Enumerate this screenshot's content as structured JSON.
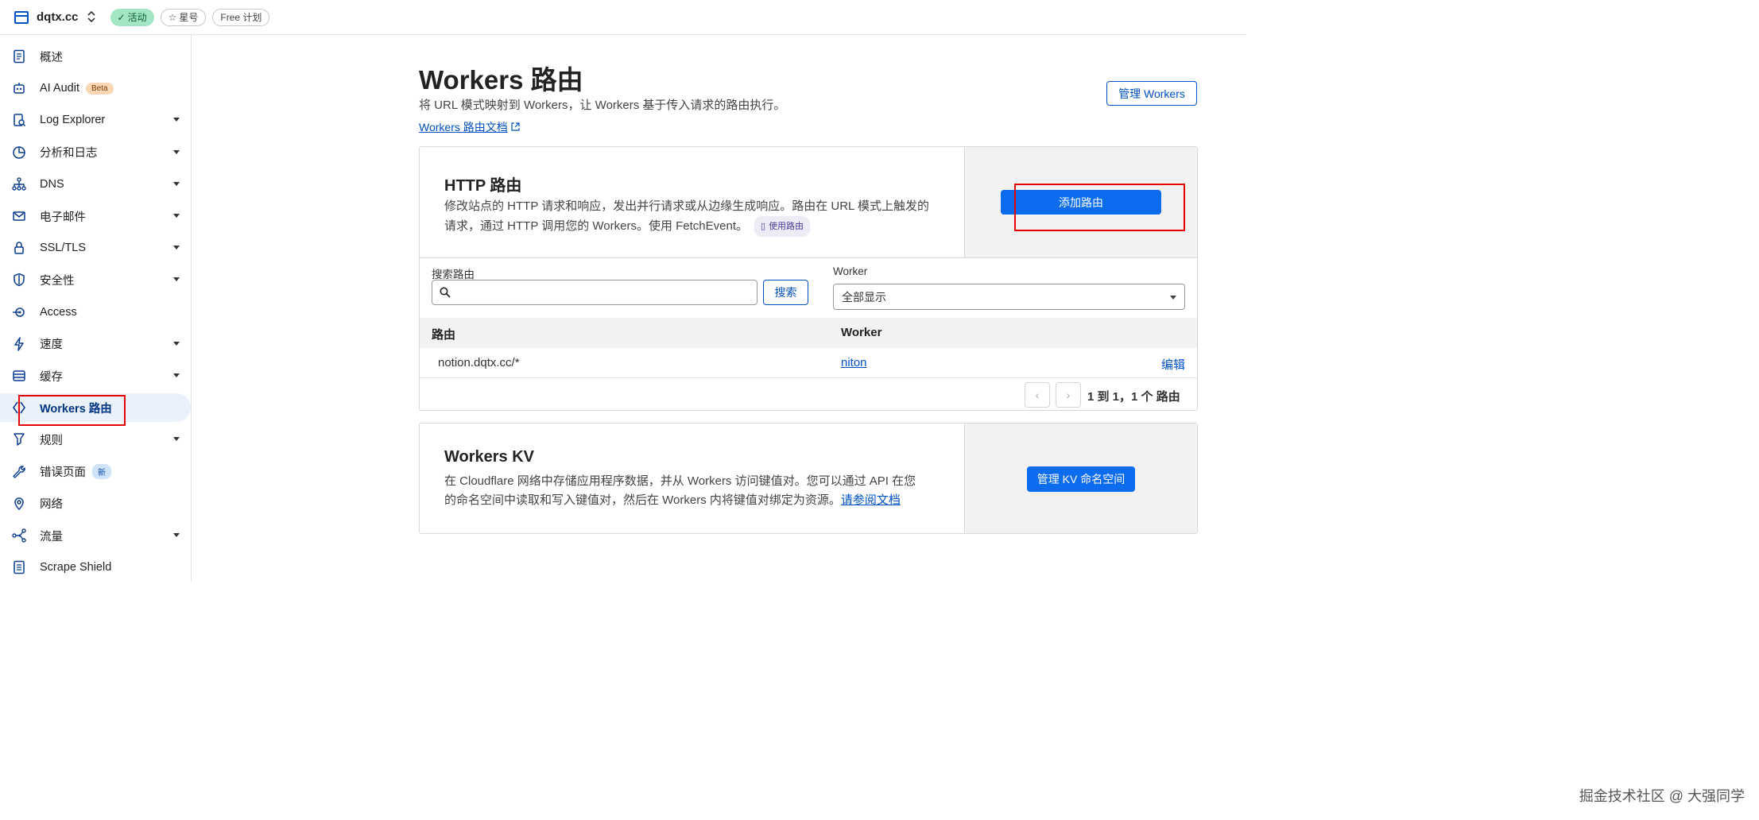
{
  "topbar": {
    "zone_name": "dqtx.cc",
    "zone_switch": "◇",
    "status_pill": "活动",
    "star_pill": "星号",
    "plan_pill": "Free 计划"
  },
  "sidebar": {
    "items": [
      {
        "label": "概述",
        "icon": "document-icon"
      },
      {
        "label": "AI Audit",
        "icon": "robot-icon",
        "badge": "Beta"
      },
      {
        "label": "Log Explorer",
        "icon": "log-icon"
      },
      {
        "label": "分析和日志",
        "icon": "pie-chart-icon"
      },
      {
        "label": "DNS",
        "icon": "network-tree-icon"
      },
      {
        "label": "电子邮件",
        "icon": "email-icon"
      },
      {
        "label": "SSL/TLS",
        "icon": "lock-icon"
      },
      {
        "label": "安全性",
        "icon": "shield-icon"
      },
      {
        "label": "Access",
        "icon": "access-icon"
      },
      {
        "label": "速度",
        "icon": "lightning-icon"
      },
      {
        "label": "缓存",
        "icon": "cache-icon"
      },
      {
        "label": "Workers 路由",
        "icon": "workers-icon"
      },
      {
        "label": "规则",
        "icon": "rules-icon"
      },
      {
        "label": "错误页面",
        "icon": "wrench-icon",
        "badge": "新"
      },
      {
        "label": "网络",
        "icon": "location-pin-icon"
      },
      {
        "label": "流量",
        "icon": "traffic-icon"
      },
      {
        "label": "Scrape Shield",
        "icon": "scrape-shield-icon"
      }
    ]
  },
  "main": {
    "title": "Workers 路由",
    "subtitle": "将 URL 模式映射到 Workers，让 Workers 基于传入请求的路由执行。",
    "doc_link": "Workers 路由文档",
    "manage_workers_button": "管理 Workers"
  },
  "http_card": {
    "title": "HTTP 路由",
    "desc_line1": "修改站点的 HTTP 请求和响应，发出并行请求或从边缘生成响应。路由在 URL 模式上触发的",
    "desc_line2": "请求，通过 HTTP 调用您的 Workers。使用 FetchEvent。",
    "chip": "使用路由",
    "add_route_button": "添加路由",
    "search_label": "搜索路由",
    "search_placeholder": "",
    "search_button": "搜索",
    "worker_label": "Worker",
    "worker_select_value": "全部显示",
    "columns": [
      "路由",
      "Worker"
    ],
    "rows": [
      {
        "route": "notion.dqtx.cc/*",
        "worker": "niton",
        "action": "编辑"
      }
    ],
    "pagination_text": "1 到 1，1 个 路由"
  },
  "kv_card": {
    "title": "Workers KV",
    "desc_line1": "在 Cloudflare 网络中存储应用程序数据，并从 Workers 访问键值对。您可以通过 API 在您",
    "desc_line2": "的命名空间中读取和写入键值对，然后在 Workers 内将键值对绑定为资源。",
    "doc_link": "请参阅文档",
    "manage_kv_button": "管理 KV 命名空间"
  },
  "watermark": "掘金技术社区 @ 大强同学",
  "colors": {
    "accent": "#0051c3",
    "primary_button": "#0b6cf0",
    "highlight_box": "#e60000",
    "active_pill": "#a3e6c4"
  }
}
